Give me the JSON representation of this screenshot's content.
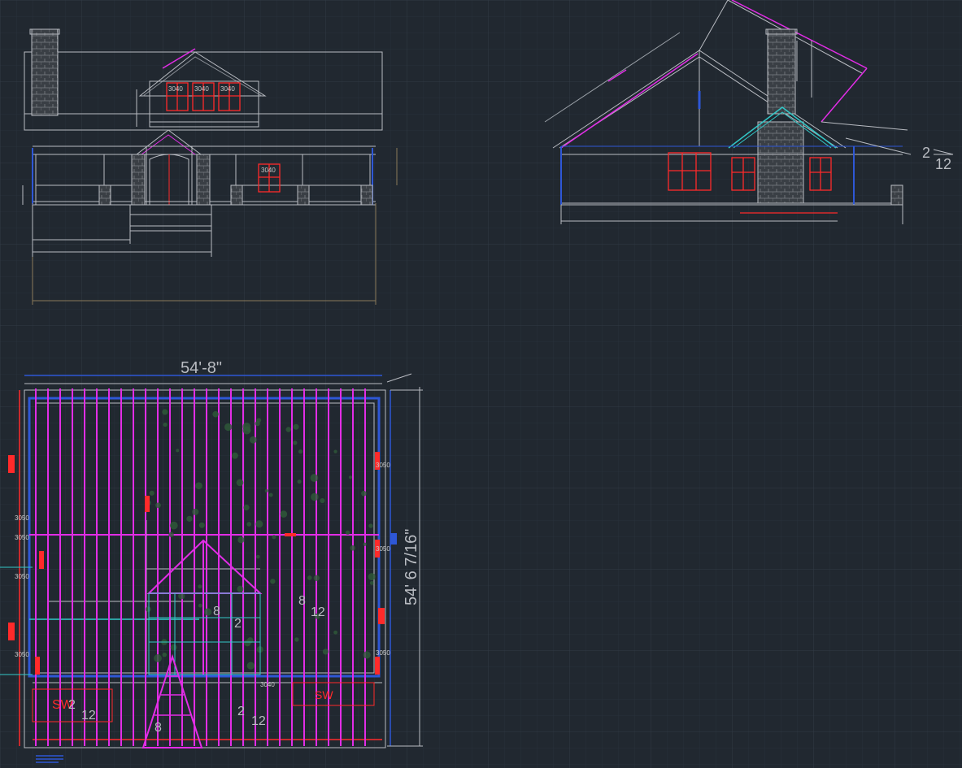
{
  "plan_dimensions": {
    "width": "54'-8\"",
    "depth": "54' 6 7/16\""
  },
  "slopes": {
    "elevation_right": {
      "rise": "2",
      "run": "12"
    },
    "plan_center": {
      "rise": "8",
      "run": "12"
    },
    "plan_valley": {
      "rise": "8",
      "run": "12"
    },
    "plan_bottom_left": {
      "rise": "2",
      "run": "12"
    },
    "plan_bottom_mid": {
      "rise": "2",
      "run": "12"
    },
    "plan_bottom_peak": {
      "rise": "8"
    },
    "plan_center_lower": {
      "rise": "2"
    }
  },
  "window_tags": {
    "front_dormer": [
      "3040",
      "3040",
      "3040"
    ],
    "front_right": "3040",
    "plan_right_1": "3050",
    "plan_right_2": "3050",
    "plan_right_3": "3050",
    "plan_left_1": "3050",
    "plan_left_2": "3050",
    "plan_left_3": "3050",
    "plan_left_4": "3050",
    "plan_bottom": "3040"
  },
  "plan_labels": {
    "sw_left": "SW",
    "sw_right": "SW"
  },
  "colors": {
    "background": "#212830",
    "grid": "#2b333c",
    "walls": "#b9bcc2",
    "windows": "#ff2a2a",
    "roof_framing": "#e22de6",
    "dimensions_blue": "#2e57d6",
    "cyan": "#32c7c7",
    "foliage": "#2f5a3a"
  }
}
